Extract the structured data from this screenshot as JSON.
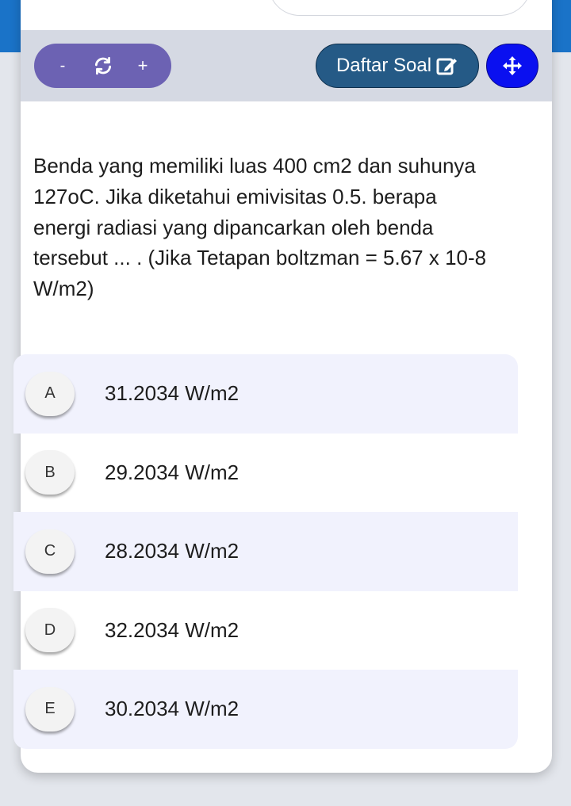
{
  "colors": {
    "top_band": "#1a73c8",
    "zoom_group": "#6c62b3",
    "daftar_button": "#255a86",
    "move_button": "#0a10f0",
    "option_shaded": "#f1f2fd"
  },
  "toolbar": {
    "zoom_out_label": "-",
    "refresh_icon": "refresh-icon",
    "zoom_in_label": "+",
    "daftar_label": "Daftar Soal",
    "daftar_icon": "edit-icon",
    "move_icon": "move-arrows-icon"
  },
  "question": {
    "text": "Benda yang memiliki luas 400 cm2 dan suhunya 127oC. Jika diketahui emivisitas 0.5. berapa energi radiasi yang dipancarkan oleh benda tersebut ... . (Jika Tetapan boltzman = 5.67 x 10-8 W/m2)"
  },
  "options": [
    {
      "letter": "A",
      "text": "31.2034 W/m2"
    },
    {
      "letter": "B",
      "text": "29.2034 W/m2"
    },
    {
      "letter": "C",
      "text": "28.2034 W/m2"
    },
    {
      "letter": "D",
      "text": "32.2034 W/m2"
    },
    {
      "letter": "E",
      "text": "30.2034 W/m2"
    }
  ]
}
